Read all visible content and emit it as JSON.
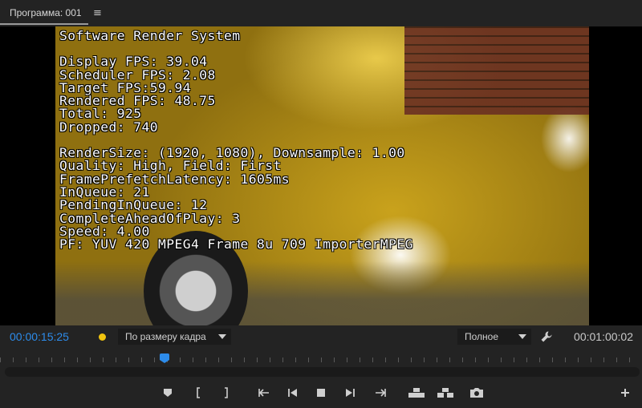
{
  "panel": {
    "tab_label": "Программа: 001",
    "menu_icon": "hamburger-icon"
  },
  "overlay": {
    "title": "Software Render System",
    "stats": [
      "Display FPS: 39.04",
      "Scheduler FPS: 2.08",
      "Target FPS:59.94",
      "Rendered FPS: 48.75",
      "Total: 925",
      "Dropped: 740"
    ],
    "render": [
      "RenderSize: (1920, 1080), Downsample: 1.00",
      "Quality: High, Field: First",
      "FramePrefetchLatency: 1605ms",
      "InQueue: 21",
      "PendingInQueue: 12",
      "CompleteAheadOfPlay: 3",
      "Speed: 4.00",
      "PF: YUV 420 MPEG4 Frame 8u 709 ImporterMPEG"
    ]
  },
  "controls": {
    "current_timecode": "00:00:15:25",
    "duration_timecode": "00:01:00:02",
    "zoom_select": "По размеру кадра",
    "quality_select": "Полное",
    "settings_icon": "wrench-icon",
    "marker_color": "#f1c40f",
    "accent_color": "#2d8ceb"
  },
  "transport": {
    "buttons": [
      "add-marker-icon",
      "mark-in-icon",
      "mark-out-icon",
      "go-to-in-icon",
      "step-back-icon",
      "stop-icon",
      "step-forward-icon",
      "go-to-out-icon",
      "lift-icon",
      "extract-icon",
      "export-frame-icon",
      "button-editor-icon"
    ]
  }
}
